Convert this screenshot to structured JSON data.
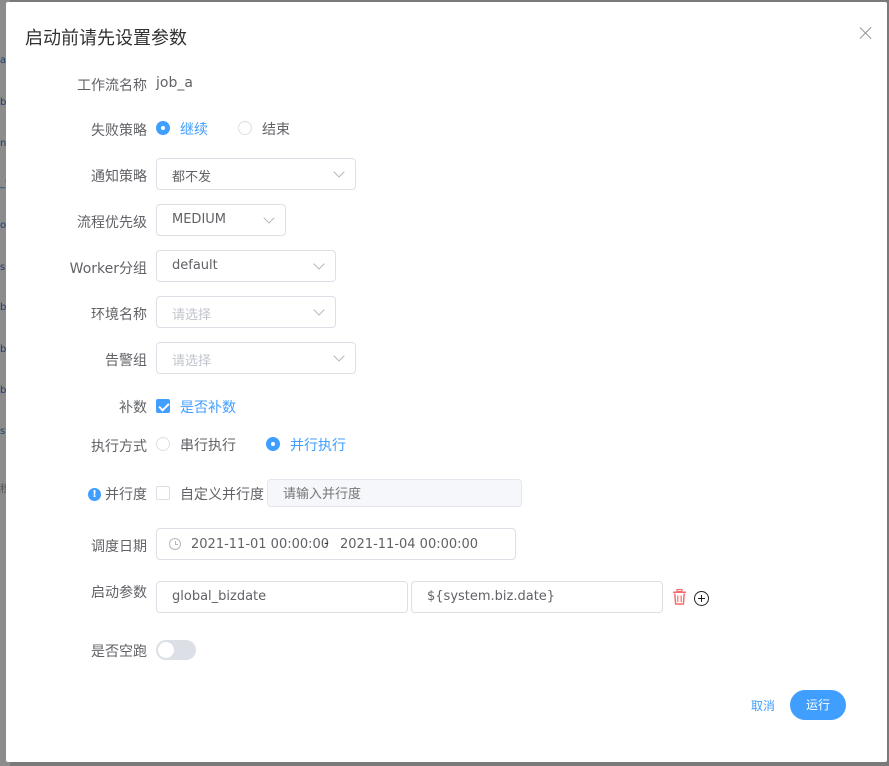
{
  "background": {
    "items": [
      "a",
      "b",
      "ni",
      "_t",
      "o",
      "s",
      "b",
      "b",
      "b",
      "st",
      "移"
    ]
  },
  "dialog": {
    "title": "启动前请先设置参数",
    "workflow_name": {
      "label": "工作流名称",
      "value": "job_a"
    },
    "failure_strategy": {
      "label": "失败策略",
      "options": [
        {
          "label": "继续",
          "selected": true
        },
        {
          "label": "结束",
          "selected": false
        }
      ]
    },
    "notify_strategy": {
      "label": "通知策略",
      "value": "都不发"
    },
    "process_priority": {
      "label": "流程优先级",
      "value": "MEDIUM"
    },
    "worker_group": {
      "label": "Worker分组",
      "value": "default"
    },
    "environment": {
      "label": "环境名称",
      "placeholder": "请选择"
    },
    "alert_group": {
      "label": "告警组",
      "placeholder": "请选择"
    },
    "complement": {
      "label": "补数",
      "checkbox_label": "是否补数",
      "checked": true
    },
    "run_mode": {
      "label": "执行方式",
      "options": [
        {
          "label": "串行执行",
          "selected": false
        },
        {
          "label": "并行执行",
          "selected": true
        }
      ]
    },
    "parallelism": {
      "label": "并行度",
      "checkbox_label": "自定义并行度",
      "checked": false,
      "placeholder": "请输入并行度"
    },
    "schedule_date": {
      "label": "调度日期",
      "start": "2021-11-01 00:00:00",
      "separator": "-",
      "end": "2021-11-04 00:00:00"
    },
    "startup_params": {
      "label": "启动参数",
      "key": "global_bizdate",
      "value": "${system.biz.date}"
    },
    "dry_run": {
      "label": "是否空跑",
      "enabled": false
    },
    "footer": {
      "cancel_label": "取消",
      "run_label": "运行"
    }
  },
  "colors": {
    "accent": "#409eff",
    "danger": "#f56c6c",
    "label": "#606266"
  }
}
